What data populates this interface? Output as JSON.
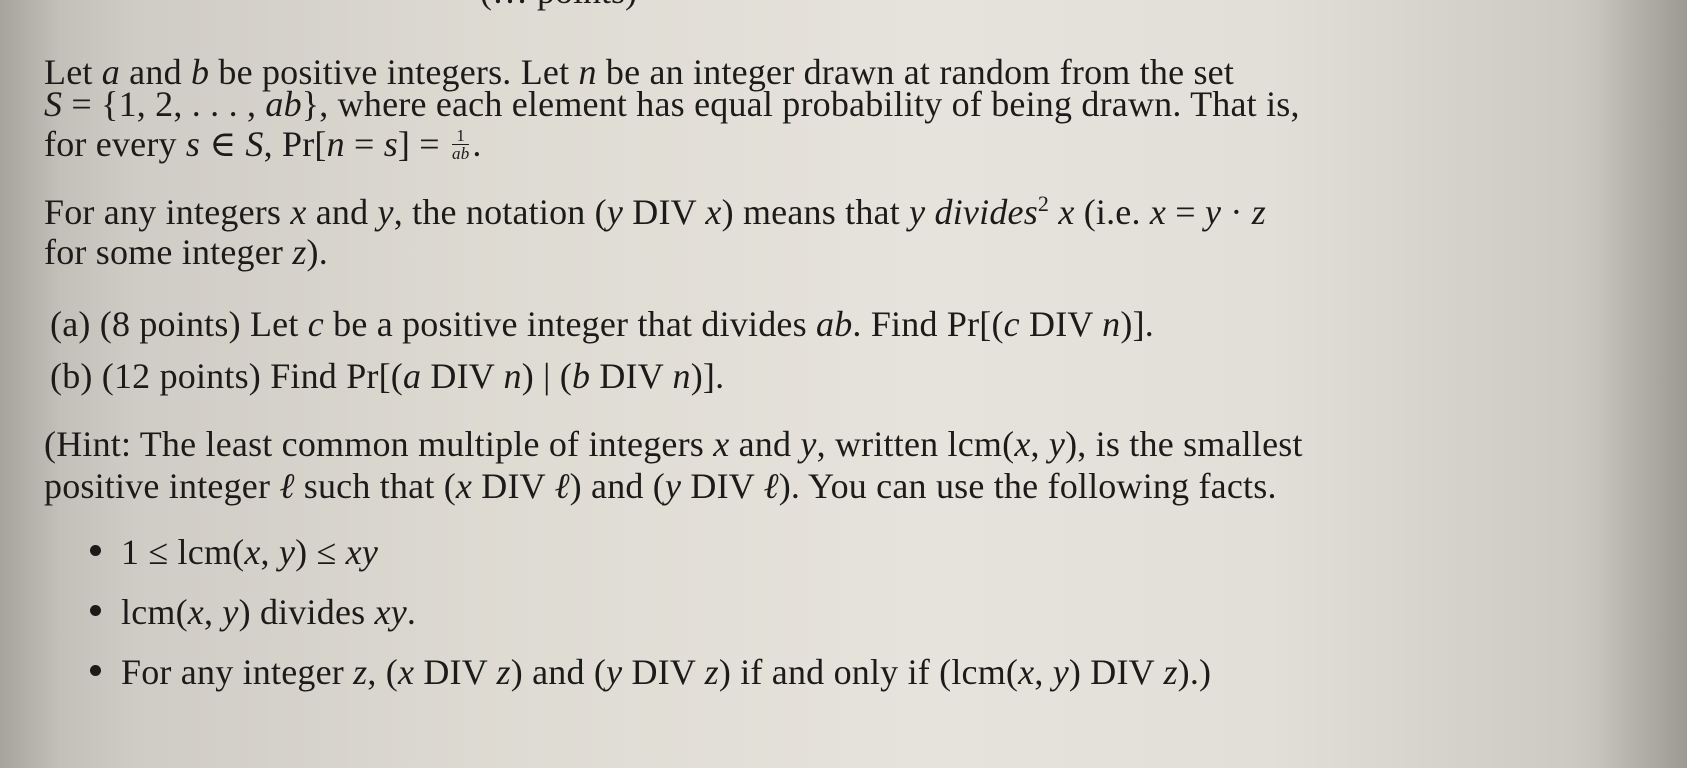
{
  "header": {
    "partial_cut_line": "(… points)"
  },
  "intro": {
    "line1": [
      "Let ",
      "a",
      " and ",
      "b",
      " be positive integers.  Let ",
      "n",
      " be an integer drawn at random from the set"
    ],
    "line2": [
      "S",
      " = {1, 2, . . . , ",
      "ab",
      "}, where each element has equal probability of being drawn.  That is,"
    ],
    "line3": [
      "for every ",
      "s",
      " ∈ ",
      "S",
      ", Pr[",
      "n",
      " = ",
      "s",
      "] = "
    ],
    "line3_frac": {
      "num": "1",
      "den": "ab"
    },
    "line3_end": "."
  },
  "definition": {
    "line1": [
      "For any integers ",
      "x",
      " and ",
      "y",
      ", the notation (",
      "y",
      " DIV ",
      "x",
      ") means that ",
      "y",
      " ",
      "divides",
      "2",
      " ",
      "x",
      " (i.e. ",
      "x",
      " = ",
      "y",
      " · ",
      "z"
    ],
    "line2": [
      "for some integer ",
      "z",
      ")."
    ]
  },
  "parts": [
    {
      "label": "(a)",
      "points": "(8 points)",
      "text": [
        "Let ",
        "c",
        " be a positive integer that divides ",
        "ab",
        ". Find Pr[(",
        "c",
        " DIV ",
        "n",
        ")]."
      ]
    },
    {
      "label": "(b)",
      "points": "(12 points)",
      "text": [
        "Find Pr[(",
        "a",
        " DIV ",
        "n",
        ") | (",
        "b",
        " DIV ",
        "n",
        ")]."
      ]
    }
  ],
  "hint": {
    "line1": [
      "(Hint: The least common multiple of integers ",
      "x",
      " and ",
      "y",
      ", written lcm(",
      "x",
      ", ",
      "y",
      "), is the smallest"
    ],
    "line2": [
      "positive integer ",
      "ℓ",
      " such that (",
      "x",
      " DIV ",
      "ℓ",
      ") and (",
      "y",
      " DIV ",
      "ℓ",
      "). You can use the following facts."
    ]
  },
  "facts": [
    [
      "1 ≤ lcm(",
      "x",
      ", ",
      "y",
      ") ≤ ",
      "xy",
      ""
    ],
    [
      "lcm(",
      "x",
      ", ",
      "y",
      ") divides ",
      "xy",
      "."
    ],
    [
      "For any integer ",
      "z",
      ", (",
      "x",
      " DIV ",
      "z",
      ") and (",
      "y",
      " DIV ",
      "z",
      ") if and only if (lcm(",
      "x",
      ", ",
      "y",
      ") DIV ",
      "z",
      ").)"
    ]
  ]
}
